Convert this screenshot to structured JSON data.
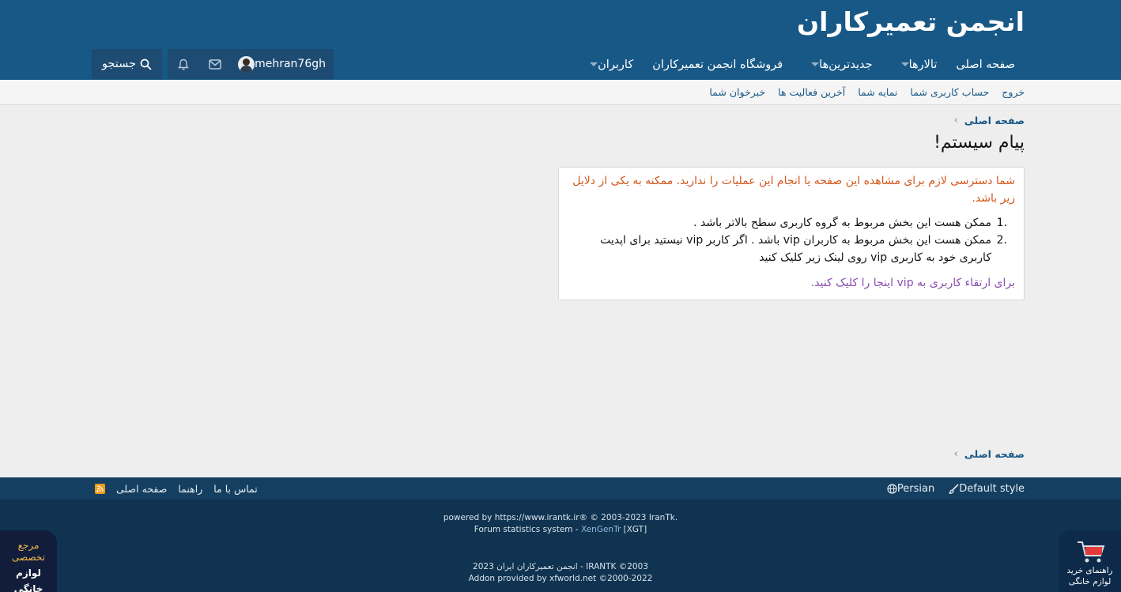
{
  "header": {
    "logo": "انجمن تعمیرکاران",
    "nav": [
      {
        "label": "صفحه اصلی",
        "dropdown": false
      },
      {
        "label": "تالارها",
        "dropdown": true
      },
      {
        "label": "جدیدترین‌ها",
        "dropdown": true
      },
      {
        "label": "فروشگاه انجمن تعمیرکاران",
        "dropdown": false
      },
      {
        "label": "کاربران",
        "dropdown": true
      }
    ],
    "username": "mehran76gh",
    "search_label": "جستجو"
  },
  "subnav": [
    "خبرخوان شما",
    "آخرین فعالیت ها",
    "نمایه شما",
    "حساب کاربری شما",
    "خروج"
  ],
  "breadcrumb": "صفحه اصلی",
  "page_title": "پیام سیستم!",
  "message": {
    "warning": "شما دسترسی لازم برای مشاهده این صفحه یا انجام این عملیات را ندارید. ممکنه به یکی از دلایل زیر باشد.",
    "items": [
      {
        "num": ".1",
        "text": "ممکن هست این بخش مربوط به گروه کاربری سطح بالاتر باشد ."
      },
      {
        "num": ".2",
        "text": "ممکن هست این بخش مربوط به کاربران vip باشد . اگر کاربر vip نیستید برای اپدیت کاربری خود به کاربری vip روی لینک زیر کلیک کنید"
      }
    ],
    "link": "برای ارتقاء کاربری به vip اینجا را کلیک کنید."
  },
  "footer": {
    "style_label": "Default style",
    "language_label": "Persian",
    "links": [
      "تماس با ما",
      "راهنما",
      "صفحه اصلی"
    ],
    "copyright_line1": "powered by https://www.irantk.ir® © 2003-2023 IranTk.",
    "stats_prefix": "Forum statistics system - ",
    "stats_link": "XenGenTr",
    "stats_suffix": " [XGT]",
    "copyright_line3": "انجمن تعمیرکاران ایران 2023 - IRANTK ©2003",
    "copyright_line4": "Addon provided by xfworld.net ©2000-2022"
  },
  "badge_left": {
    "line1": "مرجع",
    "line2": "تخصصی",
    "line3": "لوازم خانگی"
  },
  "badge_right": {
    "line1": "راهنمای خرید",
    "line2": "لوازم خانگی"
  },
  "colors": {
    "header_bg": "#185886",
    "footer_bg": "#0f3350",
    "warning": "#d2581c",
    "link_purple": "#8a4fb0"
  }
}
